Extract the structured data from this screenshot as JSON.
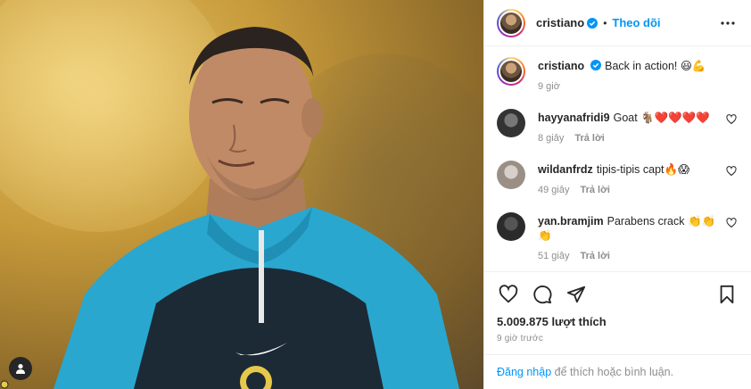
{
  "header": {
    "username": "cristiano",
    "separator": "•",
    "follow_label": "Theo dõi"
  },
  "caption": {
    "username": "cristiano",
    "text": "Back in action! 😃💪",
    "time": "9 giờ"
  },
  "comments": [
    {
      "username": "hayyanafridi9",
      "text": "Goat 🐐❤️❤️❤️❤️",
      "time": "8 giây",
      "reply": "Trả lời"
    },
    {
      "username": "wildanfrdz",
      "text": "tipis-tipis capt🔥😱",
      "time": "49 giây",
      "reply": "Trả lời"
    },
    {
      "username": "yan.bramjim",
      "text": "Parabens crack 👏👏👏",
      "time": "51 giây",
      "reply": "Trả lời"
    }
  ],
  "actions": {
    "likes": "5.009.875 lượt thích",
    "posted": "9 giờ trước",
    "login_link": "Đăng nhập",
    "login_rest": " để thích hoặc bình luận."
  },
  "colors": {
    "accent": "#0095f6",
    "muted": "#8e8e8e",
    "text": "#262626"
  }
}
